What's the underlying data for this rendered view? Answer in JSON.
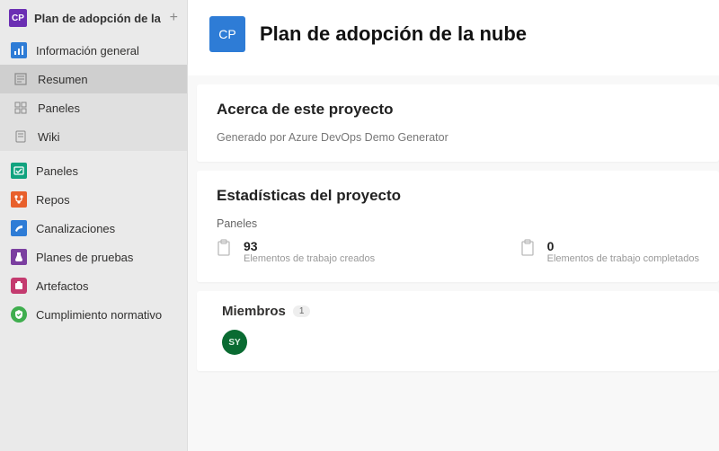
{
  "project": {
    "badge": "CP",
    "name": "Plan de adopción de la nube"
  },
  "nav": {
    "overview": "Información general",
    "summary": "Resumen",
    "dashboards": "Paneles",
    "wiki": "Wiki",
    "boards": "Paneles",
    "repos": "Repos",
    "pipelines": "Canalizaciones",
    "testplans": "Planes de pruebas",
    "artifacts": "Artefactos",
    "compliance": "Cumplimiento normativo"
  },
  "header": {
    "badge": "CP",
    "title": "Plan de adopción de la nube"
  },
  "about": {
    "title": "Acerca de este proyecto",
    "description": "Generado por Azure DevOps Demo Generator"
  },
  "stats": {
    "title": "Estadísticas del proyecto",
    "section": "Paneles",
    "created": {
      "value": "93",
      "label": "Elementos de trabajo creados"
    },
    "completed": {
      "value": "0",
      "label": "Elementos de trabajo completados"
    }
  },
  "members": {
    "title": "Miembros",
    "count": "1",
    "list": [
      {
        "initials": "SY"
      }
    ]
  }
}
